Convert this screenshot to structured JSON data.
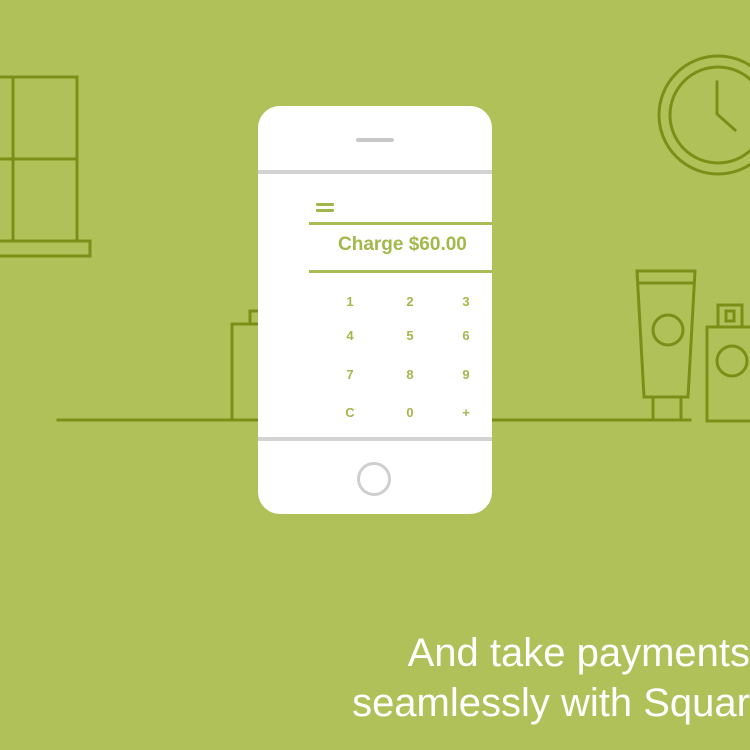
{
  "phone": {
    "charge_label": "Charge $60.00",
    "keypad": [
      [
        "1",
        "2",
        "3"
      ],
      [
        "4",
        "5",
        "6"
      ],
      [
        "7",
        "8",
        "9"
      ],
      [
        "C",
        "0",
        "+"
      ]
    ]
  },
  "caption": {
    "line1": "And take payments",
    "line2": "seamlessly with Squar"
  },
  "colors": {
    "background": "#b0c159",
    "line_art": "#7a8f17",
    "accent_text": "#a3b84b",
    "caption_text": "#ffffff"
  }
}
